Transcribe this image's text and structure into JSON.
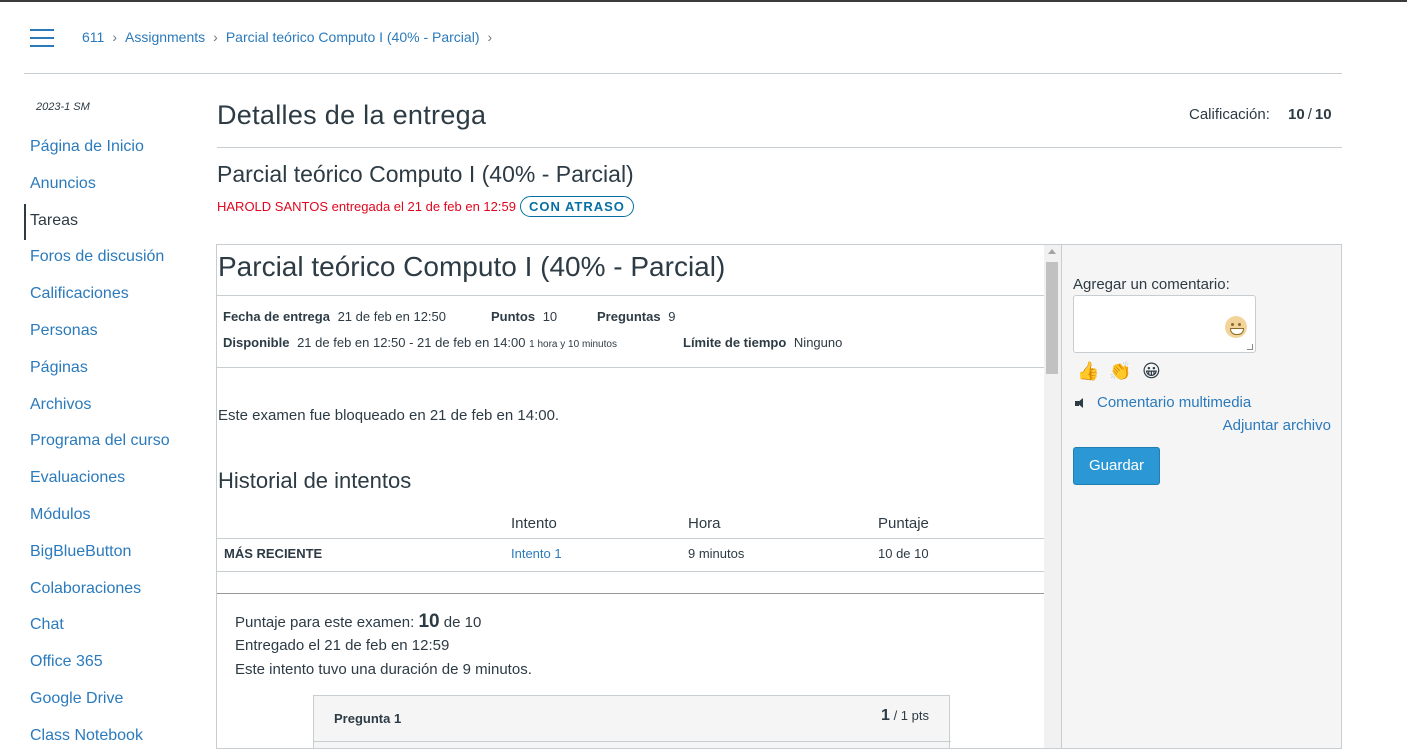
{
  "breadcrumb": {
    "items": [
      "611",
      "Assignments",
      "Parcial teórico Computo I (40% - Parcial)"
    ]
  },
  "sidebar": {
    "term": "2023-1 SM",
    "items": [
      {
        "label": "Página de Inicio"
      },
      {
        "label": "Anuncios"
      },
      {
        "label": "Tareas",
        "active": true
      },
      {
        "label": "Foros de discusión"
      },
      {
        "label": "Calificaciones"
      },
      {
        "label": "Personas"
      },
      {
        "label": "Páginas"
      },
      {
        "label": "Archivos"
      },
      {
        "label": "Programa del curso"
      },
      {
        "label": "Evaluaciones"
      },
      {
        "label": "Módulos"
      },
      {
        "label": "BigBlueButton"
      },
      {
        "label": "Colaboraciones"
      },
      {
        "label": "Chat"
      },
      {
        "label": "Office 365"
      },
      {
        "label": "Google Drive"
      },
      {
        "label": "Class Notebook"
      }
    ]
  },
  "header": {
    "title": "Detalles de la entrega",
    "grade_label": "Calificación:",
    "grade_score": "10",
    "grade_total": "10"
  },
  "submission": {
    "assignment_title": "Parcial teórico Computo I (40% - Parcial)",
    "status_text": "HAROLD SANTOS entregada el 21 de feb en 12:59",
    "late_badge": "CON ATRASO"
  },
  "quiz": {
    "title": "Parcial teórico Computo I (40% - Parcial)",
    "due_label": "Fecha de entrega",
    "due_value": "21 de feb en 12:50",
    "points_label": "Puntos",
    "points_value": "10",
    "questions_label": "Preguntas",
    "questions_value": "9",
    "available_label": "Disponible",
    "available_value": "21 de feb en 12:50 - 21 de feb en 14:00",
    "available_duration": "1 hora y 10 minutos",
    "time_limit_label": "Límite de tiempo",
    "time_limit_value": "Ninguno",
    "locked_text": "Este examen fue bloqueado en 21 de feb en 14:00.",
    "history_title": "Historial de intentos",
    "table_headers": [
      "Intento",
      "Hora",
      "Puntaje"
    ],
    "row": {
      "label": "MÁS RECIENTE",
      "attempt": "Intento 1",
      "time": "9 minutos",
      "score": "10 de 10"
    },
    "score_prefix": "Puntaje para este examen:",
    "score_value": "10",
    "score_suffix": "de 10",
    "submitted_text": "Entregado el 21 de feb en 12:59",
    "duration_text": "Este intento tuvo una duración de 9 minutos.",
    "question_name": "Pregunta 1",
    "question_points": "1",
    "question_points_suffix": "/ 1 pts"
  },
  "comments": {
    "label": "Agregar un comentario:",
    "quick_emojis": [
      "👍",
      "👏",
      "😀"
    ],
    "media_label": "Comentario multimedia",
    "attach_label": "Adjuntar archivo",
    "save_label": "Guardar"
  }
}
